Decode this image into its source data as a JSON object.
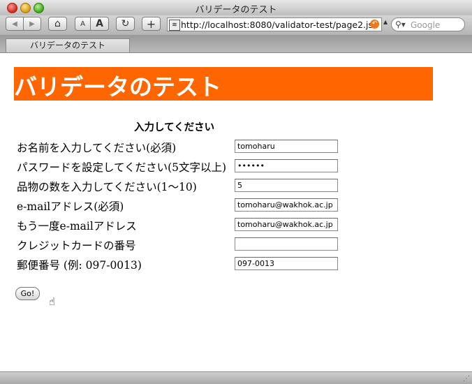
{
  "window": {
    "title": "バリデータのテスト"
  },
  "toolbar": {
    "url": "http://localhost:8080/validator-test/page2.jsf",
    "search_placeholder": "Google",
    "font_small_label": "A",
    "font_large_label": "A"
  },
  "tabs": [
    {
      "label": "バリデータのテスト"
    }
  ],
  "page": {
    "banner": "バリデータのテスト",
    "heading": "入力してください",
    "fields": [
      {
        "label": "お名前を入力してください(必須)",
        "value": "tomoharu"
      },
      {
        "label": "パスワードを設定してください(5文字以上)",
        "value": "••••••"
      },
      {
        "label": "品物の数を入力してください(1〜10)",
        "value": "5"
      },
      {
        "label": "e-mailアドレス(必須)",
        "value": "tomoharu@wakhok.ac.jp"
      },
      {
        "label": "もう一度e-mailアドレス",
        "value": "tomoharu@wakhok.ac.jp"
      },
      {
        "label": "クレジットカードの番号",
        "value": ""
      },
      {
        "label": "郵便番号 (例: 097-0013)",
        "value": "097-0013"
      }
    ],
    "submit_label": "Go!"
  },
  "colors": {
    "banner_bg": "#ff6600",
    "banner_text": "#ffffff"
  },
  "icons": [
    "back-icon",
    "forward-icon",
    "home-icon",
    "reload-icon",
    "add-bookmark-icon",
    "search-icon",
    "hand-cursor-icon"
  ]
}
